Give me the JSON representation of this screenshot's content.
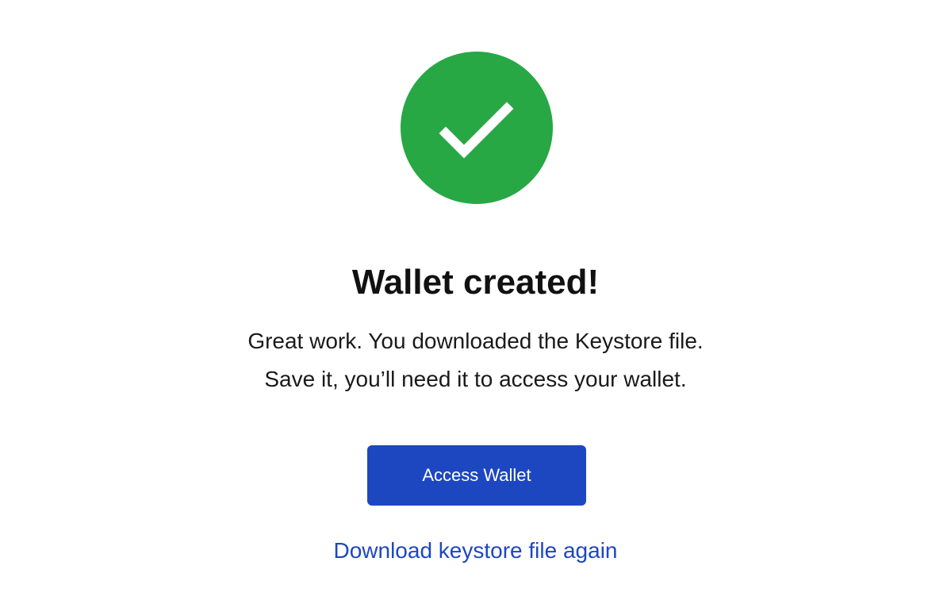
{
  "status": {
    "icon": "checkmark-icon",
    "color": "#28a745"
  },
  "title": "Wallet created!",
  "message": {
    "line1": "Great work. You downloaded the Keystore file.",
    "line2": "Save it, you’ll need it to access your wallet."
  },
  "actions": {
    "access_wallet_label": "Access Wallet",
    "download_again_label": "Download keystore file again",
    "primary_color": "#1d47c1"
  }
}
